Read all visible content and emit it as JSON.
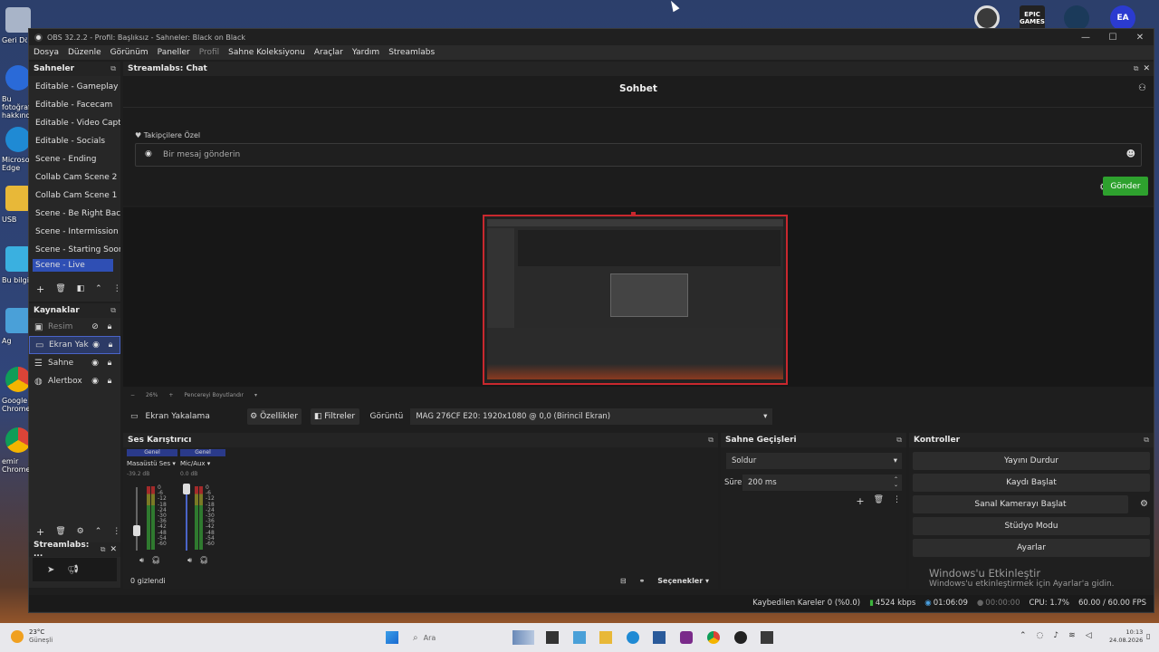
{
  "window": {
    "title": "OBS 32.2.2 - Profil: Başlıksız - Sahneler: Black on Black",
    "buttons": [
      "—",
      "☐",
      "✕"
    ]
  },
  "menu": {
    "items": [
      "Dosya",
      "Düzenle",
      "Görünüm",
      "Paneller",
      "Profil",
      "Sahne Koleksiyonu",
      "Araçlar",
      "Yardım",
      "Streamlabs"
    ]
  },
  "scenes": {
    "title": "Sahneler",
    "items": [
      "Editable - Gameplay",
      "Editable - Facecam",
      "Editable - Video Capture",
      "Editable - Socials",
      "Scene - Ending",
      "Collab Cam Scene 2",
      "Collab Cam Scene 1",
      "Scene - Be Right Back",
      "Scene - Intermission",
      "Scene - Starting Soon",
      "Scene - Live"
    ],
    "selected": "Scene - Live"
  },
  "sources": {
    "title": "Kaynaklar",
    "items": [
      {
        "name": "Resim",
        "icon": "image-icon",
        "dim": true
      },
      {
        "name": "Ekran Yak",
        "icon": "monitor-icon",
        "dim": false
      },
      {
        "name": "Sahne",
        "icon": "list-icon",
        "dim": false
      },
      {
        "name": "Alertbox",
        "icon": "globe-icon",
        "dim": false
      }
    ]
  },
  "streamlabs_dock": {
    "title": "Streamlabs: ..."
  },
  "chat": {
    "dock_title": "Streamlabs: Chat",
    "heading": "Sohbet",
    "followers_only": "Takipçilere Özel",
    "input_placeholder": "Bir mesaj gönderin",
    "send_label": "Gönder"
  },
  "preview": {
    "zoom": "26%",
    "zoom_mode": "Pencereyi Boyutlandır"
  },
  "source_toolbar": {
    "source_name": "Ekran Yakalama",
    "properties": "Özellikler",
    "filters": "Filtreler",
    "display_label": "Görüntü",
    "display_value": "MAG 276CF E20: 1920x1080 @ 0,0 (Birincil Ekran)"
  },
  "mixer": {
    "title": "Ses Karıştırıcı",
    "channels": [
      {
        "tag": "Genel",
        "name": "Masaüstü Ses",
        "db": "-39.2 dB"
      },
      {
        "tag": "Genel",
        "name": "Mic/Aux",
        "db": "0.0 dB"
      }
    ],
    "scale": [
      "0",
      "-6",
      "-12",
      "-18",
      "-24",
      "-30",
      "-36",
      "-42",
      "-48",
      "-54",
      "-60"
    ],
    "hidden": "0 gizlendi",
    "options": "Seçenekler"
  },
  "transitions": {
    "title": "Sahne Geçişleri",
    "type": "Soldur",
    "duration_label": "Süre",
    "duration_value": "200 ms"
  },
  "controls": {
    "title": "Kontroller",
    "buttons": [
      "Yayını Durdur",
      "Kaydı Başlat",
      "Sanal Kamerayı Başlat",
      "Stüdyo Modu",
      "Ayarlar"
    ]
  },
  "activation": {
    "title": "Windows'u Etkinleştir",
    "subtitle": "Windows'u etkinleştirmek için Ayarlar'a gidin."
  },
  "statusbar": {
    "dropped": "Kaybedilen Kareler 0 (%0.0)",
    "bitrate": "4524 kbps",
    "live_time": "01:06:09",
    "rec_time": "00:00:00",
    "cpu": "CPU: 1.7%",
    "fps": "60.00 / 60.00 FPS"
  },
  "desktop": {
    "labels": [
      "Geri Dönüşüm",
      "Bu fotoğraf hakkında",
      "Microsoft Edge",
      "USB",
      "Bu bilgisayar",
      "Ag",
      "Google Chrome",
      "emir Chrome"
    ]
  },
  "taskbar": {
    "weather_temp": "23°C",
    "weather_desc": "Güneşli",
    "search_placeholder": "Ara",
    "time": "10:13",
    "date": "24.08.2026"
  },
  "tray_top": [
    "EPIC GAMES",
    "EA"
  ]
}
